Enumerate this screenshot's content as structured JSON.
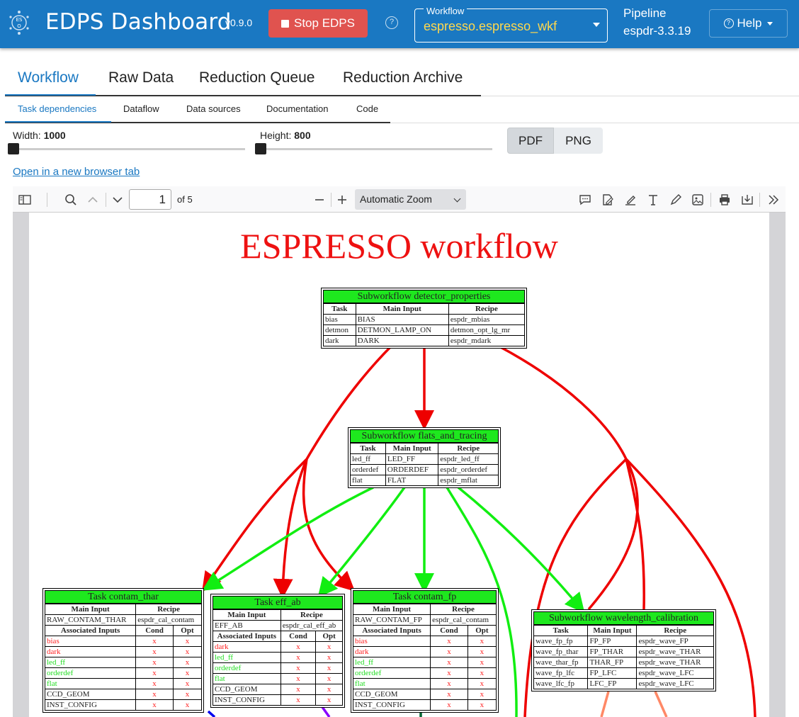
{
  "header": {
    "title": "EDPS Dashboard",
    "version": "v0.9.0",
    "stop_label": "Stop EDPS",
    "workflow_label": "Workflow",
    "workflow_value": "espresso.espresso_wkf",
    "pipeline_label": "Pipeline",
    "pipeline_value": "espdr-3.3.19",
    "help_label": "Help"
  },
  "main_tabs": [
    "Workflow",
    "Raw Data",
    "Reduction Queue",
    "Reduction Archive"
  ],
  "sub_tabs": [
    "Task dependencies",
    "Dataflow",
    "Data sources",
    "Documentation",
    "Code"
  ],
  "controls": {
    "width_label": "Width:",
    "width_value": "1000",
    "height_label": "Height:",
    "height_value": "800",
    "pdf_label": "PDF",
    "png_label": "PNG",
    "open_link": "Open in a new browser tab"
  },
  "pdf_toolbar": {
    "page": "1",
    "of_pages": "of 5",
    "zoom": "Automatic Zoom"
  },
  "diagram": {
    "title": "ESPRESSO workflow",
    "detector": {
      "title": "Subworkflow detector_properties",
      "headers": [
        "Task",
        "Main Input",
        "Recipe"
      ],
      "rows": [
        [
          "bias",
          "BIAS",
          "espdr_mbias"
        ],
        [
          "detmon",
          "DETMON_LAMP_ON",
          "detmon_opt_lg_mr"
        ],
        [
          "dark",
          "DARK",
          "espdr_mdark"
        ]
      ]
    },
    "flats": {
      "title": "Subworkflow flats_and_tracing",
      "headers": [
        "Task",
        "Main Input",
        "Recipe"
      ],
      "rows": [
        [
          "led_ff",
          "LED_FF",
          "espdr_led_ff"
        ],
        [
          "orderdef",
          "ORDERDEF",
          "espdr_orderdef"
        ],
        [
          "flat",
          "FLAT",
          "espdr_mflat"
        ]
      ]
    },
    "contam_thar": {
      "title": "Task contam_thar",
      "main_headers": [
        "Main Input",
        "Recipe"
      ],
      "main_row": [
        "RAW_CONTAM_THAR",
        "espdr_cal_contam"
      ],
      "assoc_headers": [
        "Associated Inputs",
        "Cond",
        "Opt"
      ],
      "assoc": [
        "bias",
        "dark",
        "led_ff",
        "orderdef",
        "flat",
        "CCD_GEOM",
        "INST_CONFIG"
      ]
    },
    "eff_ab": {
      "title": "Task eff_ab",
      "main_headers": [
        "Main Input",
        "Recipe"
      ],
      "main_row": [
        "EFF_AB",
        "espdr_cal_eff_ab"
      ],
      "assoc_headers": [
        "Associated Inputs",
        "Cond",
        "Opt"
      ],
      "assoc": [
        "dark",
        "led_ff",
        "orderdef",
        "flat",
        "CCD_GEOM",
        "INST_CONFIG"
      ]
    },
    "contam_fp": {
      "title": "Task contam_fp",
      "main_headers": [
        "Main Input",
        "Recipe"
      ],
      "main_row": [
        "RAW_CONTAM_FP",
        "espdr_cal_contam"
      ],
      "assoc_headers": [
        "Associated Inputs",
        "Cond",
        "Opt"
      ],
      "assoc": [
        "bias",
        "dark",
        "led_ff",
        "orderdef",
        "flat",
        "CCD_GEOM",
        "INST_CONFIG"
      ]
    },
    "wavelength": {
      "title": "Subworkflow wavelength_calibration",
      "headers": [
        "Task",
        "Main Input",
        "Recipe"
      ],
      "rows": [
        [
          "wave_fp_fp",
          "FP_FP",
          "espdr_wave_FP"
        ],
        [
          "wave_fp_thar",
          "FP_THAR",
          "espdr_wave_THAR"
        ],
        [
          "wave_thar_fp",
          "THAR_FP",
          "espdr_wave_THAR"
        ],
        [
          "wave_fp_lfc",
          "FP_LFC",
          "espdr_wave_LFC"
        ],
        [
          "wave_lfc_fp",
          "LFC_FP",
          "espdr_wave_LFC"
        ]
      ]
    },
    "mark": "x"
  }
}
